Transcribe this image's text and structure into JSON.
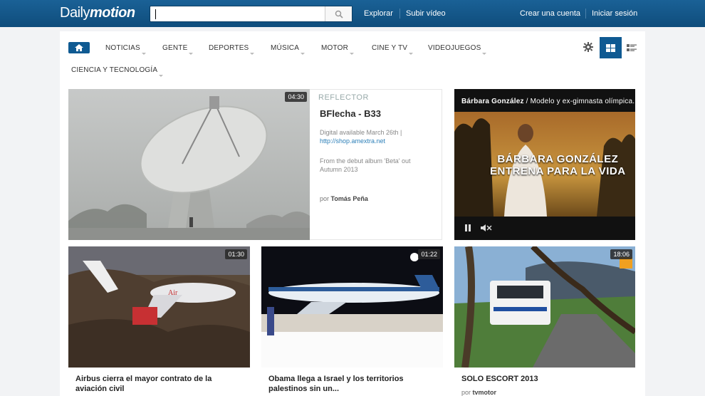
{
  "header": {
    "logo_part1": "Daily",
    "logo_part2": "motion",
    "search_placeholder": "",
    "nav": [
      "Explorar",
      "Subir vídeo"
    ],
    "account": [
      "Crear una cuenta",
      "Iniciar sesión"
    ]
  },
  "categories": [
    "NOTICIAS",
    "GENTE",
    "DEPORTES",
    "MÚSICA",
    "MOTOR",
    "CINE Y TV",
    "VIDEOJUEGOS",
    "CIENCIA Y TECNOLOGÍA"
  ],
  "featured": {
    "duration": "04:30",
    "section": "REFLECTOR",
    "title": "BFlecha - B33",
    "desc1": "Digital available March 26th |",
    "link": "http://shop.amextra.net",
    "desc2": "From the debut album 'Beta' out Autumn 2013",
    "by_label": "por",
    "author": "Tomás Peña"
  },
  "ad": {
    "caption_name": "Bárbara González",
    "caption_rest": " / Modelo y ex-gimnasta olímpica.",
    "headline1": "BÁRBARA GONZÁLEZ",
    "headline2": "ENTRENA PARA LA VIDA"
  },
  "cards": [
    {
      "duration": "01:30",
      "title": "Airbus cierra el mayor contrato de la aviación civil",
      "author": ""
    },
    {
      "duration": "01:22",
      "title": "Obama llega a Israel y los territorios palestinos sin un...",
      "author": ""
    },
    {
      "duration": "18:06",
      "title": "SOLO ESCORT 2013",
      "by_label": "por",
      "author": "tvmotor"
    }
  ],
  "colors": {
    "brand": "#0f5a92",
    "link": "#2c7fb8"
  }
}
